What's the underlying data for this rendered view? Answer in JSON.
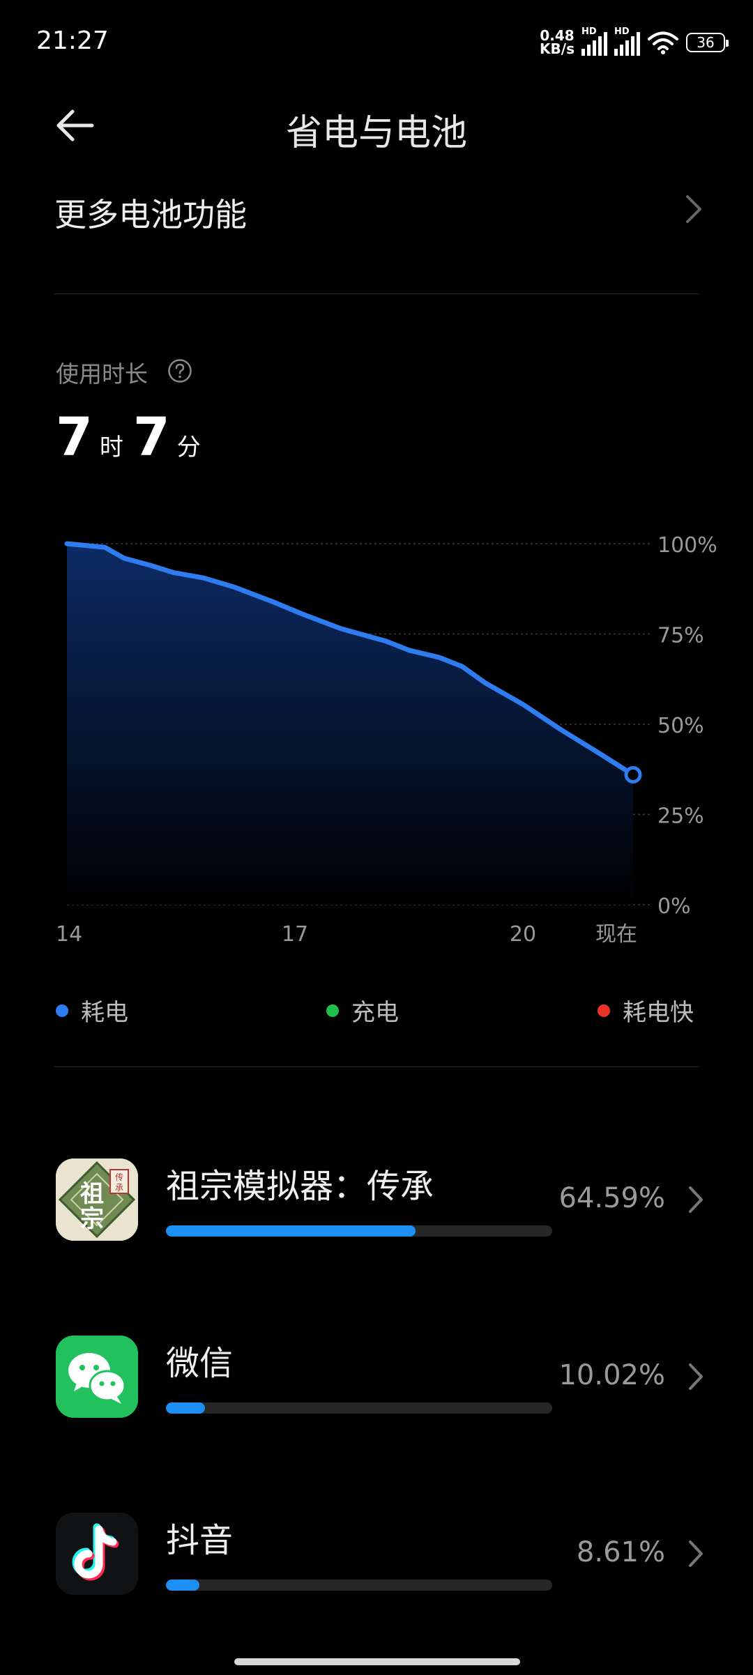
{
  "status_bar": {
    "time": "21:27",
    "net_speed_value": "0.48",
    "net_speed_unit": "KB/s",
    "signal_1_label": "HD",
    "signal_2_label": "HD",
    "battery_level": "36"
  },
  "header": {
    "title": "省电与电池",
    "back_icon": "arrow-left-icon"
  },
  "more_battery": {
    "label": "更多电池功能",
    "icon": "chevron-right-icon"
  },
  "usage": {
    "label": "使用时长",
    "help_icon": "question-circle-icon",
    "hours": "7",
    "hours_unit": "时",
    "minutes": "7",
    "minutes_unit": "分"
  },
  "chart_data": {
    "type": "area",
    "x_ticks": [
      "14",
      "17",
      "20",
      "现在"
    ],
    "y_ticks": [
      "100%",
      "75%",
      "50%",
      "25%",
      "0%"
    ],
    "ylim": [
      0,
      100
    ],
    "xlim": [
      14,
      21.45
    ],
    "grid": true,
    "series": [
      {
        "name": "耗电",
        "x": [
          14.0,
          14.5,
          14.75,
          15.1,
          15.4,
          15.8,
          16.2,
          16.7,
          17.1,
          17.6,
          18.2,
          18.5,
          18.9,
          19.2,
          19.5,
          20.0,
          20.5,
          21.0,
          21.45
        ],
        "y": [
          100,
          99,
          96,
          94,
          92,
          90.5,
          88,
          84,
          80.5,
          76.5,
          73,
          70.5,
          68.5,
          66,
          61.5,
          55.5,
          48.5,
          42,
          36
        ]
      }
    ],
    "colors": {
      "line": "#2f7cf0",
      "fill_top": "#0d2d6a"
    }
  },
  "legend": [
    {
      "label": "耗电",
      "color": "#2f7cf0"
    },
    {
      "label": "充电",
      "color": "#1fbf4e"
    },
    {
      "label": "耗电快",
      "color": "#ec3328"
    }
  ],
  "apps": [
    {
      "name": "祖宗模拟器：传承",
      "percent_text": "64.59%",
      "percent": 64.59,
      "icon": "game-ancestor-icon",
      "icon_glyph": "祖宗",
      "icon_badge": "传承"
    },
    {
      "name": "微信",
      "percent_text": "10.02%",
      "percent": 10.02,
      "icon": "wechat-icon"
    },
    {
      "name": "抖音",
      "percent_text": "8.61%",
      "percent": 8.61,
      "icon": "douyin-icon"
    }
  ]
}
